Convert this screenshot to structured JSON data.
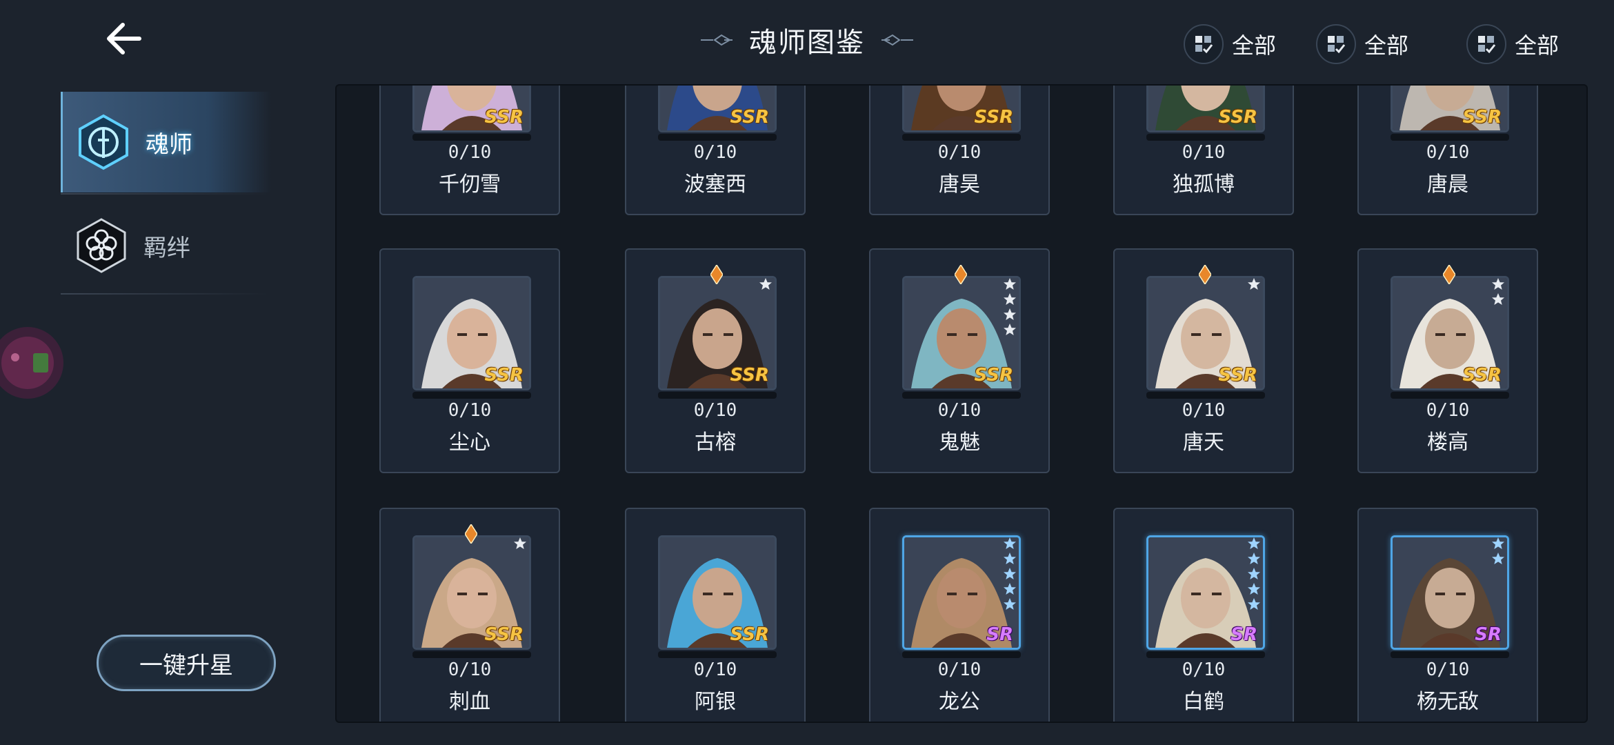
{
  "header": {
    "title": "魂师图鉴",
    "filters": [
      {
        "label": "全部",
        "icon": "filter-grid-icon"
      },
      {
        "label": "全部",
        "icon": "filter-grid-icon"
      },
      {
        "label": "全部",
        "icon": "filter-grid-icon"
      }
    ]
  },
  "sidebar": {
    "tabs": [
      {
        "label": "魂师",
        "icon": "soul-master-icon",
        "active": true
      },
      {
        "label": "羁绊",
        "icon": "bond-flower-icon",
        "active": false
      }
    ],
    "upstar_button": "一键升星"
  },
  "colors": {
    "background": "#1c232d",
    "card": "#1d2634",
    "ssr": "#f6c443",
    "sr": "#d77cff",
    "active_tab": "#3d5a7a"
  },
  "characters": [
    {
      "name": "千仞雪",
      "count": "0/10",
      "rarity": "SSR",
      "stars": 0,
      "gem": false
    },
    {
      "name": "波塞西",
      "count": "0/10",
      "rarity": "SSR",
      "stars": 0,
      "gem": false
    },
    {
      "name": "唐昊",
      "count": "0/10",
      "rarity": "SSR",
      "stars": 0,
      "gem": false
    },
    {
      "name": "独孤博",
      "count": "0/10",
      "rarity": "SSR",
      "stars": 0,
      "gem": false
    },
    {
      "name": "唐晨",
      "count": "0/10",
      "rarity": "SSR",
      "stars": 0,
      "gem": false
    },
    {
      "name": "尘心",
      "count": "0/10",
      "rarity": "SSR",
      "stars": 0,
      "gem": false
    },
    {
      "name": "古榕",
      "count": "0/10",
      "rarity": "SSR",
      "stars": 1,
      "gem": true
    },
    {
      "name": "鬼魅",
      "count": "0/10",
      "rarity": "SSR",
      "stars": 4,
      "gem": true
    },
    {
      "name": "唐天",
      "count": "0/10",
      "rarity": "SSR",
      "stars": 1,
      "gem": true
    },
    {
      "name": "楼高",
      "count": "0/10",
      "rarity": "SSR",
      "stars": 2,
      "gem": true
    },
    {
      "name": "刺血",
      "count": "0/10",
      "rarity": "SSR",
      "stars": 1,
      "gem": true
    },
    {
      "name": "阿银",
      "count": "0/10",
      "rarity": "SSR",
      "stars": 0,
      "gem": false
    },
    {
      "name": "龙公",
      "count": "0/10",
      "rarity": "SR",
      "stars": 5,
      "gem": false
    },
    {
      "name": "白鹤",
      "count": "0/10",
      "rarity": "SR",
      "stars": 5,
      "gem": false
    },
    {
      "name": "杨无敌",
      "count": "0/10",
      "rarity": "SR",
      "stars": 2,
      "gem": false
    }
  ]
}
